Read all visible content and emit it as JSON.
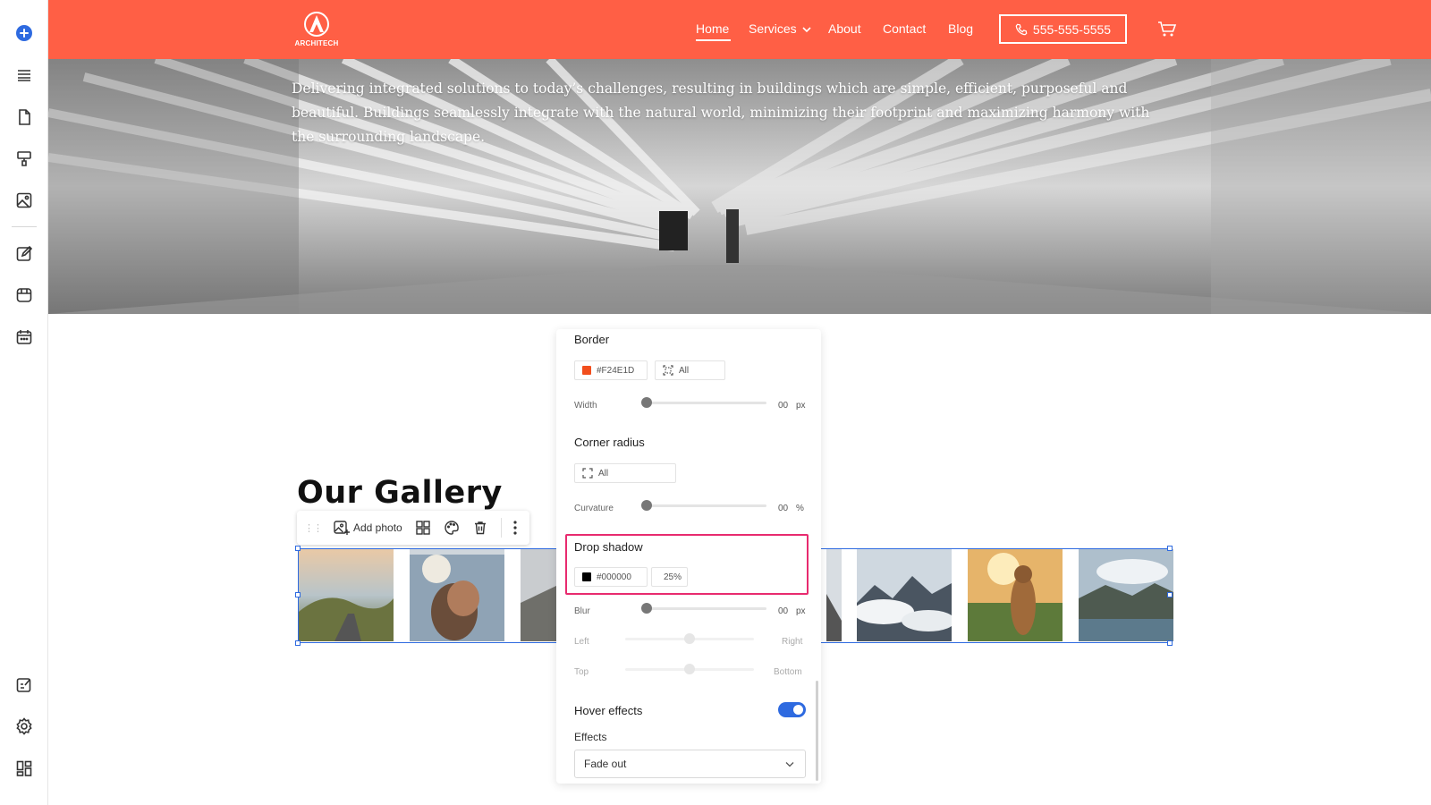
{
  "header": {
    "logo_text": "ARCHITECH",
    "nav": [
      "Home",
      "Services",
      "About",
      "Contact",
      "Blog"
    ],
    "phone": "555-555-5555"
  },
  "hero": {
    "text": "Delivering integrated solutions to today’s challenges, resulting in buildings which are simple, efficient, purposeful and beautiful. Buildings seamlessly integrate with the natural world, minimizing their footprint and maximizing harmony with the surrounding landscape."
  },
  "gallery": {
    "title": "Our Gallery",
    "add_photo": "Add photo"
  },
  "panel": {
    "border": {
      "title": "Border",
      "color": "#F24E1D",
      "sides": "All",
      "width_label": "Width",
      "width_value": "00",
      "width_unit": "px"
    },
    "corner": {
      "title": "Corner radius",
      "corners": "All",
      "curvature_label": "Curvature",
      "curvature_value": "00",
      "curvature_unit": "%"
    },
    "shadow": {
      "title": "Drop shadow",
      "color": "#000000",
      "opacity": "25%",
      "blur_label": "Blur",
      "blur_value": "00",
      "blur_unit": "px",
      "left_label": "Left",
      "right_label": "Right",
      "top_label": "Top",
      "bottom_label": "Bottom"
    },
    "hover": {
      "title": "Hover effects",
      "enabled": true,
      "effects_label": "Effects",
      "effect_value": "Fade out"
    }
  },
  "colors": {
    "brand": "#ff5f45",
    "accent": "#2e6ae0",
    "highlight": "#e82b6f",
    "border_swatch": "#F24E1D",
    "shadow_swatch": "#000000"
  },
  "icons": {
    "rail": [
      "add-icon",
      "sections-icon",
      "page-icon",
      "paint-roller-icon",
      "image-icon",
      "edit-icon",
      "store-icon",
      "calendar-icon",
      "design-icon",
      "settings-icon",
      "apps-icon"
    ],
    "header": [
      "logo-icon",
      "phone-icon",
      "cart-icon"
    ],
    "toolbar": [
      "drag-handle-icon",
      "add-photo-icon",
      "layout-icon",
      "palette-icon",
      "trash-icon",
      "more-icon"
    ]
  }
}
